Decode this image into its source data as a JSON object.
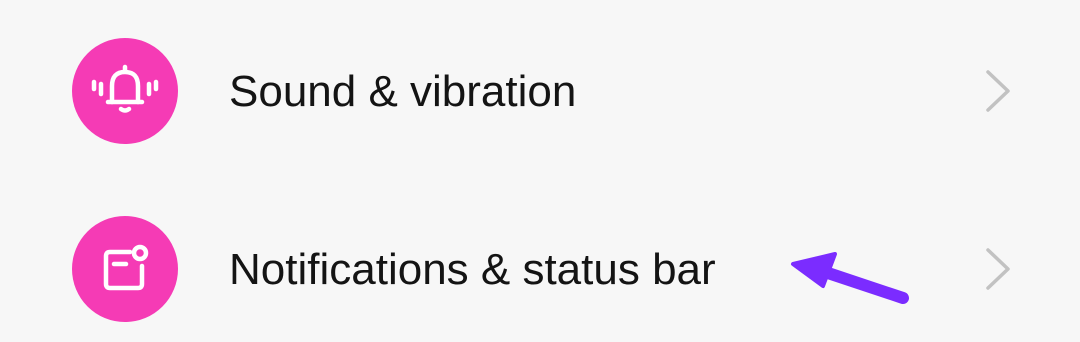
{
  "settings": {
    "items": [
      {
        "label": "Sound & vibration",
        "icon": "bell-sound-icon",
        "icon_bg": "#f53bb5"
      },
      {
        "label": "Notifications & status bar",
        "icon": "notification-icon",
        "icon_bg": "#f53bb5"
      }
    ]
  },
  "annotation": {
    "icon": "arrow-pointer-icon",
    "color": "#7b2cff"
  },
  "colors": {
    "background": "#f7f7f7",
    "text": "#141414",
    "chevron": "#c2c2c2"
  }
}
